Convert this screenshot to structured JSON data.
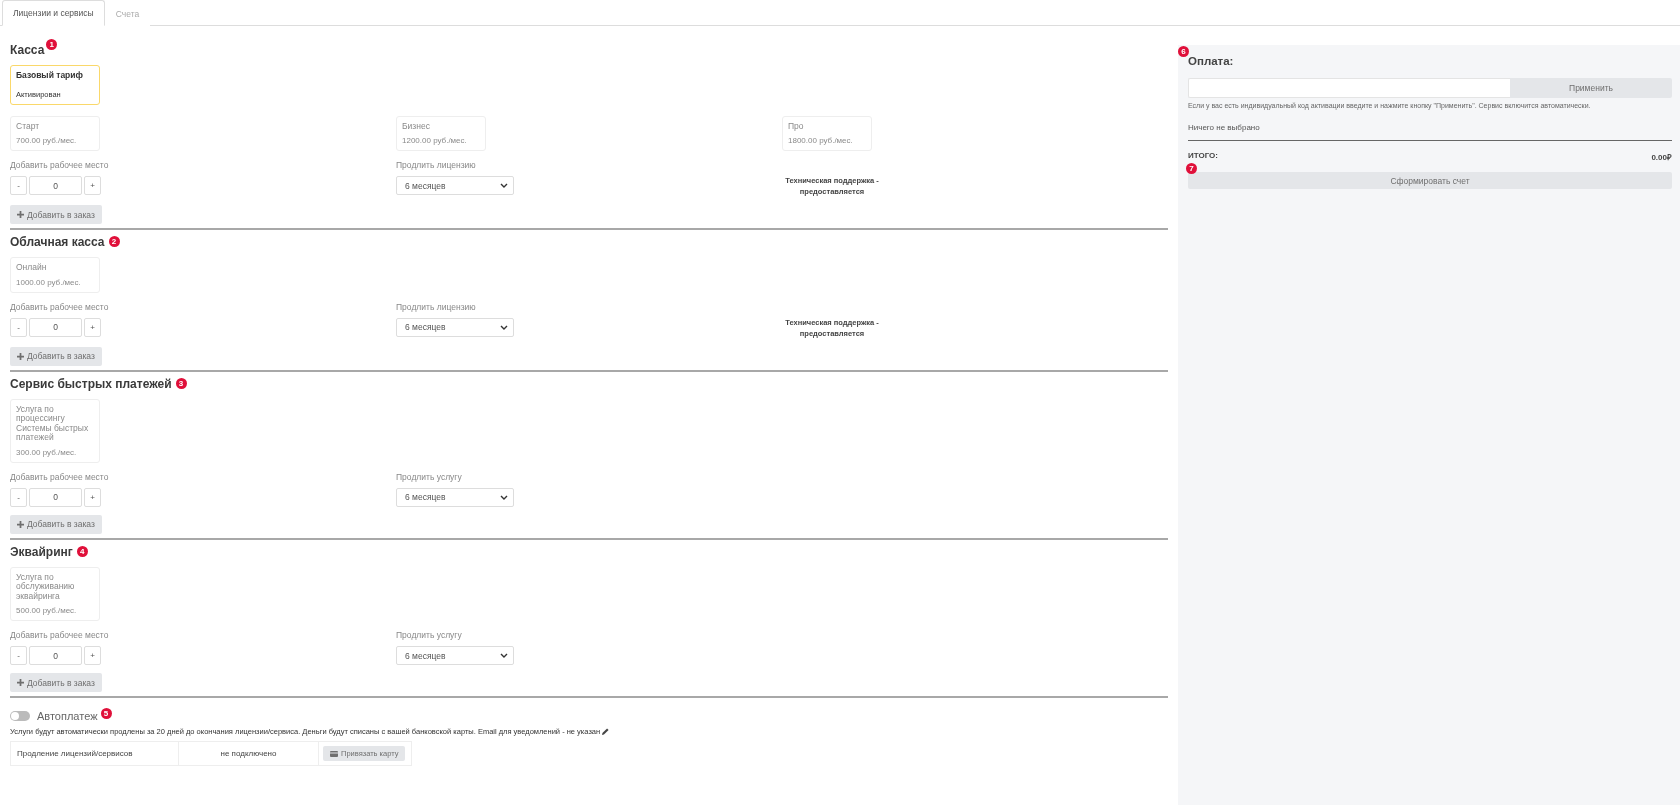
{
  "tabs": [
    {
      "label": "Лицензии и сервисы",
      "selected": true
    },
    {
      "label": "Счета",
      "selected": false
    }
  ],
  "sections": [
    {
      "title": "Касса",
      "badge": "1",
      "active_plan": {
        "name": "Базовый тариф",
        "status": "Активирован",
        "selected": true
      },
      "tariffs": [
        {
          "name": "Старт",
          "price": "700.00 руб./мес.",
          "disabled": true
        },
        {
          "name": "Бизнес",
          "price": "1200.00 руб./мес.",
          "disabled": true
        },
        {
          "name": "Про",
          "price": "1800.00 руб./мес.",
          "disabled": true
        }
      ],
      "seats": {
        "label": "Добавить рабочее место",
        "minus": "-",
        "value": "0",
        "plus": "+"
      },
      "extend": {
        "label": "Продлить лицензию",
        "value": "6 месяцев"
      },
      "support": "Техническая поддержка - предоставляется",
      "add_button": {
        "label": "Добавить в заказ",
        "disabled": true
      }
    },
    {
      "title": "Облачная касса",
      "badge": "2",
      "tariffs": [
        {
          "name": "Онлайн",
          "price": "1000.00 руб./мес.",
          "disabled": true
        }
      ],
      "seats": {
        "label": "Добавить рабочее место",
        "minus": "-",
        "value": "0",
        "plus": "+"
      },
      "extend": {
        "label": "Продлить лицензию",
        "value": "6 месяцев"
      },
      "support": "Техническая поддержка - предоставляется",
      "add_button": {
        "label": "Добавить в заказ",
        "disabled": true
      }
    },
    {
      "title": "Сервис быстрых платежей",
      "badge": "3",
      "tariffs": [
        {
          "name": "Услуга по процессингу Системы быстрых платежей",
          "price": "300.00 руб./мес.",
          "disabled": true
        }
      ],
      "seats": {
        "label": "Добавить рабочее место",
        "minus": "-",
        "value": "0",
        "plus": "+"
      },
      "extend": {
        "label": "Продлить услугу",
        "value": "6 месяцев"
      },
      "add_button": {
        "label": "Добавить в заказ",
        "disabled": true
      }
    },
    {
      "title": "Эквайринг",
      "badge": "4",
      "tariffs": [
        {
          "name": "Услуга по обслуживанию эквайринга",
          "price": "500.00 руб./мес.",
          "disabled": true
        }
      ],
      "seats": {
        "label": "Добавить рабочее место",
        "minus": "-",
        "value": "0",
        "plus": "+"
      },
      "extend": {
        "label": "Продлить услугу",
        "value": "6 месяцев"
      },
      "add_button": {
        "label": "Добавить в заказ",
        "disabled": true
      }
    }
  ],
  "autopay": {
    "label": "Автоплатеж",
    "on": false,
    "badge": "5",
    "note": "Услуги будут автоматически продлены за 20 дней до окончания лицензии/сервиса. Деньги будут списаны с вашей банковской карты. Email для уведомлений - не указан",
    "row": [
      "Продление лицензий/сервисов",
      "не подключено"
    ],
    "button": {
      "label": "Привязать карту",
      "disabled": true
    }
  },
  "payment": {
    "title": "Оплата:",
    "badge": "6",
    "apply_button": {
      "label": "Применить",
      "disabled": true
    },
    "hint": "Если у вас есть индивидуальный код активации введите и нажмите кнопку \"Применить\". Сервис включится автоматически.",
    "selection": "Ничего не выбрано",
    "total_label": "ИТОГО:",
    "total_value": "0.00₽",
    "submit": {
      "label": "Сформировать счет",
      "disabled": true
    },
    "submit_badge": "7"
  }
}
